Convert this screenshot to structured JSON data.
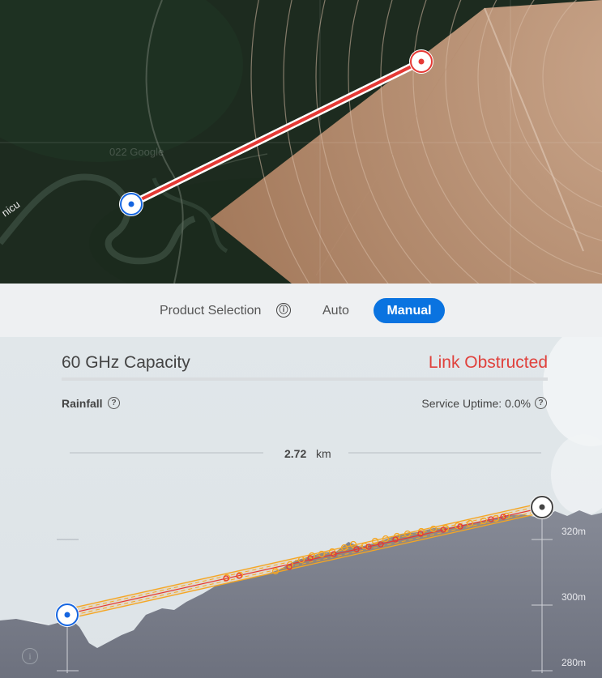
{
  "map": {
    "place_label": "nicu",
    "watermark": "022 Google",
    "link_color": "#e53935",
    "site_a_color": "#1565e0",
    "site_b_color": "#e53935"
  },
  "controls": {
    "product_selection_label": "Product Selection",
    "info_icon": "ⓘ",
    "auto_label": "Auto",
    "manual_label": "Manual",
    "active_mode": "Manual",
    "accent_color": "#0a73e0"
  },
  "panel": {
    "capacity_title": "60 GHz Capacity",
    "link_status": "Link Obstructed",
    "status_color": "#e0413c",
    "rainfall_label": "Rainfall",
    "service_uptime_label": "Service Uptime: 0.0%",
    "help_icon": "?",
    "distance_value": "2.72",
    "distance_unit": "km",
    "elevation_labels": [
      "320m",
      "300m",
      "280m"
    ],
    "bottom_info_icon": "i"
  }
}
